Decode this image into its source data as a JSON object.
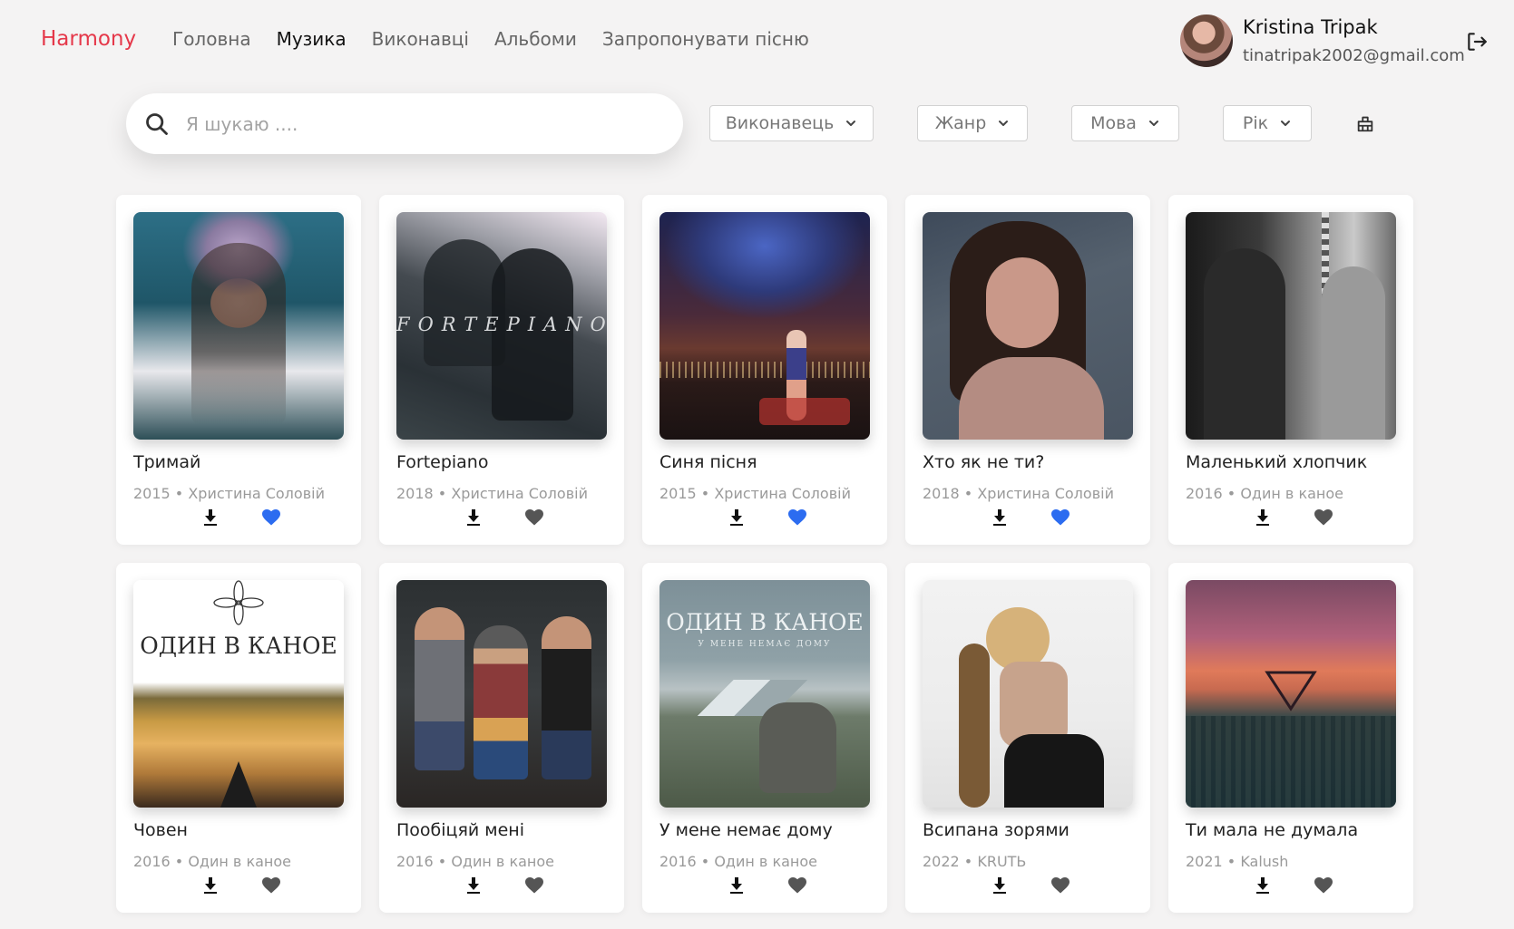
{
  "header": {
    "logo": "Harmony",
    "nav": [
      {
        "label": "Головна",
        "active": false
      },
      {
        "label": "Музика",
        "active": true
      },
      {
        "label": "Виконавці",
        "active": false
      },
      {
        "label": "Альбоми",
        "active": false
      },
      {
        "label": "Запропонувати пісню",
        "active": false
      }
    ],
    "user": {
      "name": "Kristina Tripak",
      "email": "tinatripak2002@gmail.com"
    }
  },
  "search": {
    "placeholder": "Я шукаю ....",
    "value": ""
  },
  "filters": [
    {
      "label": "Виконавець"
    },
    {
      "label": "Жанр"
    },
    {
      "label": "Мова"
    },
    {
      "label": "Рік"
    }
  ],
  "songs": [
    {
      "title": "Тримай",
      "year": "2015",
      "artist": "Христина Соловій",
      "meta": "2015 • Христина Соловій",
      "liked": true
    },
    {
      "title": "Fortepiano",
      "year": "2018",
      "artist": "Христина Соловій",
      "meta": "2018 • Христина Соловій",
      "liked": false,
      "cover_text": "FORTEPIANO"
    },
    {
      "title": "Синя пісня",
      "year": "2015",
      "artist": "Христина Соловій",
      "meta": "2015 • Христина Соловій",
      "liked": true
    },
    {
      "title": "Хто як не ти?",
      "year": "2018",
      "artist": "Христина Соловій",
      "meta": "2018 • Христина Соловій",
      "liked": true
    },
    {
      "title": "Маленький хлопчик",
      "year": "2016",
      "artist": "Один в каное",
      "meta": "2016 • Один в каное",
      "liked": false
    },
    {
      "title": "Човен",
      "year": "2016",
      "artist": "Один в каное",
      "meta": "2016 • Один в каное",
      "liked": false,
      "cover_text": "ОДИН В КАНОЕ"
    },
    {
      "title": "Пообіцяй мені",
      "year": "2016",
      "artist": "Один в каное",
      "meta": "2016 • Один в каное",
      "liked": false
    },
    {
      "title": "У мене немає дому",
      "year": "2016",
      "artist": "Один в каное",
      "meta": "2016 • Один в каное",
      "liked": false,
      "cover_text": "ОДИН В КАНОЕ",
      "cover_subtext": "У МЕНЕ НЕМАЄ ДОМУ"
    },
    {
      "title": "Всипана зорями",
      "year": "2022",
      "artist": "KRUTЬ",
      "meta": "2022 • KRUTЬ",
      "liked": false
    },
    {
      "title": "Ти мала не думала",
      "year": "2021",
      "artist": "Kalush",
      "meta": "2021 • Kalush",
      "liked": false
    }
  ],
  "colors": {
    "accent": "#e5384a",
    "liked": "#2c6cf0",
    "unliked": "#555555"
  }
}
